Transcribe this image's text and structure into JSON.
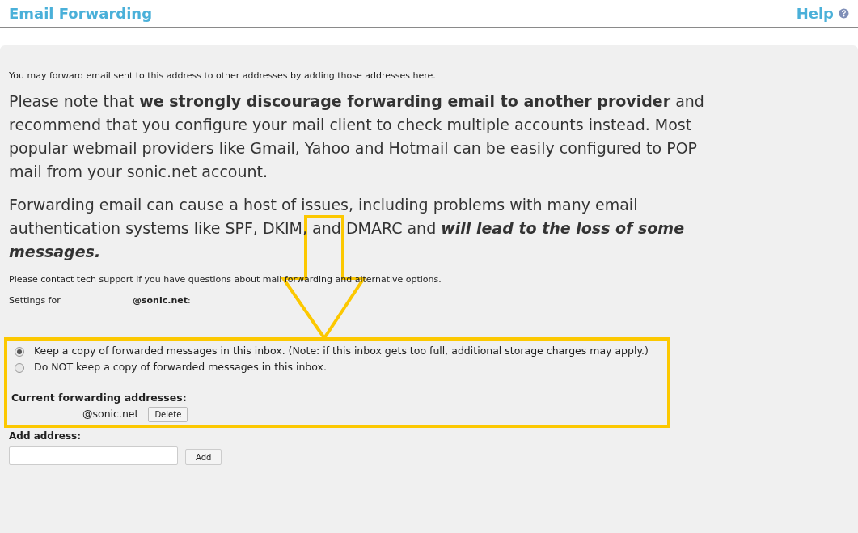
{
  "header": {
    "title": "Email Forwarding",
    "help": "Help"
  },
  "intro": "You may forward email sent to this address to other addresses by adding those addresses here.",
  "notes": [
    {
      "text": "Please note that **we strongly discourage forwarding email to another provider** and recommend that you configure your mail client to check multiple accounts instead. Most popular webmail providers like Gmail, Yahoo and Hotmail can be easily configured to POP mail from your sonic.net account."
    },
    {
      "text": "Forwarding email can cause a host of issues, including problems with many email authentication systems like SPF, DKIM, and DMARC and",
      "emphasis": "will lead to the loss of some messages."
    }
  ],
  "contact": "Please contact tech support if you have questions about mail forwarding and alternative options.",
  "settings": {
    "label": "Settings for",
    "address": "@sonic.net",
    "suffix": ":"
  },
  "options": [
    {
      "label": "Keep a copy of forwarded messages in this inbox. (Note: if this inbox gets too full, additional storage charges may apply.)",
      "selected": true
    },
    {
      "label": "Do NOT keep a copy of forwarded messages in this inbox.",
      "selected": false
    }
  ],
  "current": {
    "heading": "Current forwarding addresses:",
    "addresses": [
      {
        "address": "@sonic.net",
        "button": "Delete"
      }
    ]
  },
  "add": {
    "label": "Add address:",
    "button": "Add"
  }
}
